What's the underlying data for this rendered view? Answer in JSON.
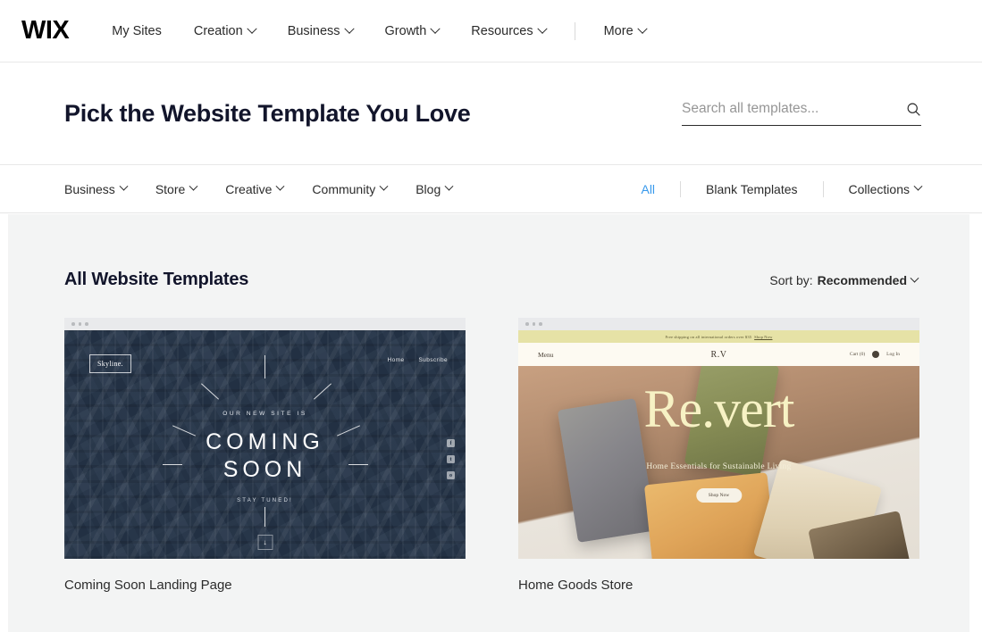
{
  "topnav": {
    "logo": "WIX",
    "items": [
      {
        "label": "My Sites",
        "has_caret": false
      },
      {
        "label": "Creation",
        "has_caret": true
      },
      {
        "label": "Business",
        "has_caret": true
      },
      {
        "label": "Growth",
        "has_caret": true
      },
      {
        "label": "Resources",
        "has_caret": true
      }
    ],
    "more": {
      "label": "More",
      "has_caret": true
    }
  },
  "header": {
    "title": "Pick the Website Template You Love",
    "search": {
      "placeholder": "Search all templates...",
      "value": "",
      "icon": "search-icon"
    }
  },
  "categories": {
    "left": [
      {
        "label": "Business",
        "has_caret": true
      },
      {
        "label": "Store",
        "has_caret": true
      },
      {
        "label": "Creative",
        "has_caret": true
      },
      {
        "label": "Community",
        "has_caret": true
      },
      {
        "label": "Blog",
        "has_caret": true
      }
    ],
    "right": [
      {
        "label": "All",
        "active": true,
        "has_caret": false
      },
      {
        "label": "Blank Templates",
        "active": false,
        "has_caret": false
      },
      {
        "label": "Collections",
        "active": false,
        "has_caret": true
      }
    ],
    "active_color": "#3899ec"
  },
  "main": {
    "section_title": "All Website Templates",
    "sort": {
      "label": "Sort by:",
      "value": "Recommended"
    },
    "cards": [
      {
        "title": "Coming Soon Landing Page",
        "preview": {
          "logo": "Skyline.",
          "nav": [
            "Home",
            "Subscribe"
          ],
          "kicker": "OUR NEW SITE IS",
          "headline_line1": "COMING",
          "headline_line2": "SOON",
          "subtext": "STAY TUNED!",
          "social": [
            "f",
            "t",
            "o"
          ],
          "scroll_arrow": "↓"
        }
      },
      {
        "title": "Home Goods Store",
        "preview": {
          "banner": "Free shipping on all international orders over $35",
          "banner_link": "Shop Now",
          "menu": "Menu",
          "logo": "R.V",
          "cart": "Cart (0)",
          "login": "Log In",
          "headline": "Re.vert",
          "subhead": "Home Essentials for Sustainable Living",
          "button": "Shop Now"
        }
      }
    ]
  }
}
